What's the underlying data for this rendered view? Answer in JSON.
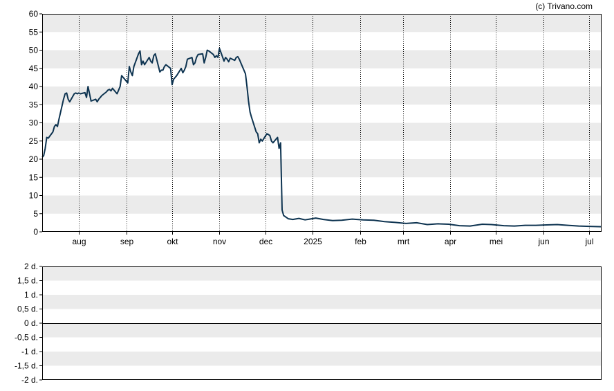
{
  "credit": "(c) Trivano.com",
  "colors": {
    "line": "#0d3350",
    "band": "#ebebeb",
    "grid": "#000000",
    "frame": "#000000"
  },
  "chart_data": [
    {
      "type": "line",
      "title": "",
      "xlabel": "",
      "ylabel": "",
      "ylim": [
        0,
        60
      ],
      "yticks": [
        0,
        5,
        10,
        15,
        20,
        25,
        30,
        35,
        40,
        45,
        50,
        55,
        60
      ],
      "x_range": [
        "2024-07-08",
        "2025-07-09"
      ],
      "x_ticks": [
        {
          "label": "aug",
          "date": "2024-08-01"
        },
        {
          "label": "sep",
          "date": "2024-09-01"
        },
        {
          "label": "okt",
          "date": "2024-10-01"
        },
        {
          "label": "nov",
          "date": "2024-11-01"
        },
        {
          "label": "dec",
          "date": "2024-12-01"
        },
        {
          "label": "2025",
          "date": "2025-01-01"
        },
        {
          "label": "feb",
          "date": "2025-02-01"
        },
        {
          "label": "mrt",
          "date": "2025-03-01"
        },
        {
          "label": "apr",
          "date": "2025-04-01"
        },
        {
          "label": "mei",
          "date": "2025-05-01"
        },
        {
          "label": "jun",
          "date": "2025-06-01"
        },
        {
          "label": "jul",
          "date": "2025-07-01"
        }
      ],
      "grid": "vertical dotted at month starts, alternating horizontal bands",
      "series": [
        {
          "points": [
            [
              "2024-07-08",
              20.5
            ],
            [
              "2024-07-09",
              21.0
            ],
            [
              "2024-07-10",
              23.0
            ],
            [
              "2024-07-11",
              26.0
            ],
            [
              "2024-07-12",
              25.8
            ],
            [
              "2024-07-15",
              27.5
            ],
            [
              "2024-07-16",
              29.0
            ],
            [
              "2024-07-17",
              29.5
            ],
            [
              "2024-07-18",
              29.0
            ],
            [
              "2024-07-19",
              31.0
            ],
            [
              "2024-07-22",
              36.5
            ],
            [
              "2024-07-23",
              38.0
            ],
            [
              "2024-07-24",
              38.2
            ],
            [
              "2024-07-25",
              36.5
            ],
            [
              "2024-07-26",
              35.8
            ],
            [
              "2024-07-29",
              38.0
            ],
            [
              "2024-07-30",
              38.2
            ],
            [
              "2024-07-31",
              38.0
            ],
            [
              "2024-08-01",
              38.2
            ],
            [
              "2024-08-02",
              38.0
            ],
            [
              "2024-08-05",
              38.3
            ],
            [
              "2024-08-06",
              37.0
            ],
            [
              "2024-08-07",
              40.0
            ],
            [
              "2024-08-08",
              38.0
            ],
            [
              "2024-08-09",
              36.0
            ],
            [
              "2024-08-12",
              36.5
            ],
            [
              "2024-08-13",
              35.8
            ],
            [
              "2024-08-14",
              36.5
            ],
            [
              "2024-08-15",
              37.0
            ],
            [
              "2024-08-16",
              37.5
            ],
            [
              "2024-08-19",
              38.5
            ],
            [
              "2024-08-20",
              39.0
            ],
            [
              "2024-08-21",
              39.2
            ],
            [
              "2024-08-22",
              38.8
            ],
            [
              "2024-08-23",
              39.5
            ],
            [
              "2024-08-26",
              38.0
            ],
            [
              "2024-08-27",
              39.0
            ],
            [
              "2024-08-28",
              40.0
            ],
            [
              "2024-08-29",
              43.0
            ],
            [
              "2024-08-30",
              42.5
            ],
            [
              "2024-09-02",
              41.0
            ],
            [
              "2024-09-03",
              45.5
            ],
            [
              "2024-09-04",
              44.0
            ],
            [
              "2024-09-05",
              43.0
            ],
            [
              "2024-09-06",
              45.5
            ],
            [
              "2024-09-09",
              49.0
            ],
            [
              "2024-09-10",
              49.8
            ],
            [
              "2024-09-11",
              46.0
            ],
            [
              "2024-09-12",
              47.0
            ],
            [
              "2024-09-13",
              46.0
            ],
            [
              "2024-09-16",
              48.0
            ],
            [
              "2024-09-17",
              47.0
            ],
            [
              "2024-09-18",
              46.5
            ],
            [
              "2024-09-19",
              48.5
            ],
            [
              "2024-09-20",
              49.0
            ],
            [
              "2024-09-23",
              44.0
            ],
            [
              "2024-09-24",
              44.5
            ],
            [
              "2024-09-25",
              44.5
            ],
            [
              "2024-09-26",
              45.5
            ],
            [
              "2024-09-27",
              46.0
            ],
            [
              "2024-09-30",
              45.0
            ],
            [
              "2024-10-01",
              40.5
            ],
            [
              "2024-10-02",
              42.0
            ],
            [
              "2024-10-03",
              42.5
            ],
            [
              "2024-10-04",
              43.0
            ],
            [
              "2024-10-07",
              45.0
            ],
            [
              "2024-10-08",
              43.8
            ],
            [
              "2024-10-09",
              44.5
            ],
            [
              "2024-10-10",
              45.5
            ],
            [
              "2024-10-11",
              47.5
            ],
            [
              "2024-10-14",
              48.0
            ],
            [
              "2024-10-15",
              46.0
            ],
            [
              "2024-10-16",
              46.5
            ],
            [
              "2024-10-17",
              48.0
            ],
            [
              "2024-10-18",
              48.8
            ],
            [
              "2024-10-21",
              49.0
            ],
            [
              "2024-10-22",
              46.5
            ],
            [
              "2024-10-23",
              48.0
            ],
            [
              "2024-10-24",
              50.0
            ],
            [
              "2024-10-25",
              49.8
            ],
            [
              "2024-10-28",
              48.8
            ],
            [
              "2024-10-29",
              48.0
            ],
            [
              "2024-10-30",
              48.5
            ],
            [
              "2024-10-31",
              48.0
            ],
            [
              "2024-11-01",
              50.5
            ],
            [
              "2024-11-04",
              47.0
            ],
            [
              "2024-11-05",
              48.0
            ],
            [
              "2024-11-06",
              47.5
            ],
            [
              "2024-11-07",
              46.8
            ],
            [
              "2024-11-08",
              47.8
            ],
            [
              "2024-11-11",
              47.2
            ],
            [
              "2024-11-12",
              48.0
            ],
            [
              "2024-11-13",
              48.2
            ],
            [
              "2024-11-14",
              47.5
            ],
            [
              "2024-11-15",
              46.5
            ],
            [
              "2024-11-18",
              43.5
            ],
            [
              "2024-11-19",
              40.0
            ],
            [
              "2024-11-20",
              36.0
            ],
            [
              "2024-11-21",
              33.0
            ],
            [
              "2024-11-22",
              31.5
            ],
            [
              "2024-11-25",
              27.5
            ],
            [
              "2024-11-26",
              27.0
            ],
            [
              "2024-11-27",
              24.5
            ],
            [
              "2024-11-28",
              25.5
            ],
            [
              "2024-11-29",
              25.0
            ],
            [
              "2024-12-02",
              27.0
            ],
            [
              "2024-12-03",
              26.8
            ],
            [
              "2024-12-04",
              26.5
            ],
            [
              "2024-12-05",
              25.0
            ],
            [
              "2024-12-06",
              24.5
            ],
            [
              "2024-12-09",
              26.0
            ],
            [
              "2024-12-10",
              23.0
            ],
            [
              "2024-12-11",
              24.5
            ],
            [
              "2024-12-12",
              6.0
            ],
            [
              "2024-12-13",
              4.5
            ],
            [
              "2024-12-16",
              3.6
            ],
            [
              "2024-12-19",
              3.4
            ],
            [
              "2024-12-23",
              3.7
            ],
            [
              "2024-12-27",
              3.3
            ],
            [
              "2024-12-30",
              3.5
            ],
            [
              "2025-01-03",
              3.8
            ],
            [
              "2025-01-08",
              3.4
            ],
            [
              "2025-01-14",
              3.1
            ],
            [
              "2025-01-20",
              3.2
            ],
            [
              "2025-01-27",
              3.5
            ],
            [
              "2025-02-03",
              3.3
            ],
            [
              "2025-02-10",
              3.2
            ],
            [
              "2025-02-17",
              2.8
            ],
            [
              "2025-02-24",
              2.6
            ],
            [
              "2025-03-03",
              2.3
            ],
            [
              "2025-03-10",
              2.5
            ],
            [
              "2025-03-17",
              2.0
            ],
            [
              "2025-03-24",
              2.2
            ],
            [
              "2025-03-31",
              2.1
            ],
            [
              "2025-04-07",
              1.7
            ],
            [
              "2025-04-14",
              1.6
            ],
            [
              "2025-04-22",
              2.1
            ],
            [
              "2025-04-28",
              2.0
            ],
            [
              "2025-05-06",
              1.7
            ],
            [
              "2025-05-13",
              1.6
            ],
            [
              "2025-05-20",
              1.8
            ],
            [
              "2025-05-27",
              1.8
            ],
            [
              "2025-06-03",
              1.9
            ],
            [
              "2025-06-10",
              2.0
            ],
            [
              "2025-06-17",
              1.8
            ],
            [
              "2025-06-24",
              1.6
            ],
            [
              "2025-07-01",
              1.5
            ],
            [
              "2025-07-09",
              1.4
            ]
          ]
        }
      ]
    },
    {
      "type": "line",
      "title": "",
      "xlabel": "",
      "ylabel": "",
      "ylim": [
        -2,
        2
      ],
      "ytick_labels": [
        "2 d.",
        "1,5 d.",
        "1 d.",
        "0,5 d.",
        "0 d.",
        "-0,5 d.",
        "-1 d.",
        "-1,5 d.",
        "-2 d."
      ],
      "yticks": [
        2,
        1.5,
        1,
        0.5,
        0,
        -0.5,
        -1,
        -1.5,
        -2
      ],
      "zero_line": 0,
      "series": []
    }
  ]
}
